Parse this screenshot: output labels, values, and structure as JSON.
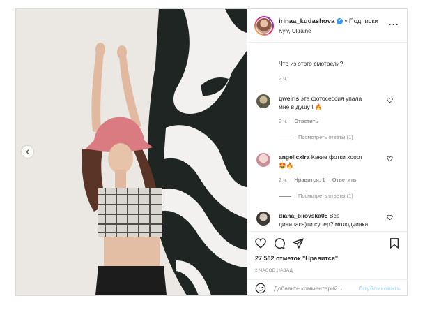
{
  "post": {
    "username": "irinaa_kudashova",
    "follow_label": "• Подписки",
    "location": "Kyiv, Ukraine"
  },
  "caption": {
    "text": "Что из этого смотрели?",
    "time": "2 ч."
  },
  "comments": [
    {
      "username": "qweiris",
      "text_line1": "эта фотосессия упала",
      "text_line2": "мне в душу ! 🔥",
      "time": "2 ч.",
      "reply_label": "Ответить",
      "view_replies": "Посмотреть ответы (1)"
    },
    {
      "username": "angelicxira",
      "text_line1": "Какие фотки хооот",
      "text_line2": "🤩🔥",
      "time": "2 ч.",
      "likes_label": "Нравится: 1",
      "reply_label": "Ответить",
      "view_replies": "Посмотреть ответы (1)"
    },
    {
      "username": "diana_biiovska05",
      "text_line1": "Все",
      "text_line2": "дивилась)ти супер? молодчинка"
    }
  ],
  "stats": {
    "likes": "27 582 отметок \"Нравится\"",
    "posted": "2 ЧАСОВ НАЗАД"
  },
  "add_comment": {
    "placeholder": "Добавьте комментарий...",
    "publish_label": "Опубликовать"
  },
  "icons": {
    "prev": "chevron-left-icon",
    "more": "more-horizontal-icon",
    "like": "heart-icon",
    "comment": "comment-icon",
    "share": "send-icon",
    "save": "bookmark-icon",
    "emoji": "emoji-icon"
  },
  "colors": {
    "link_disabled": "#b2dffc",
    "verified": "#3897f0",
    "secondary_text": "#8e8e8e"
  }
}
